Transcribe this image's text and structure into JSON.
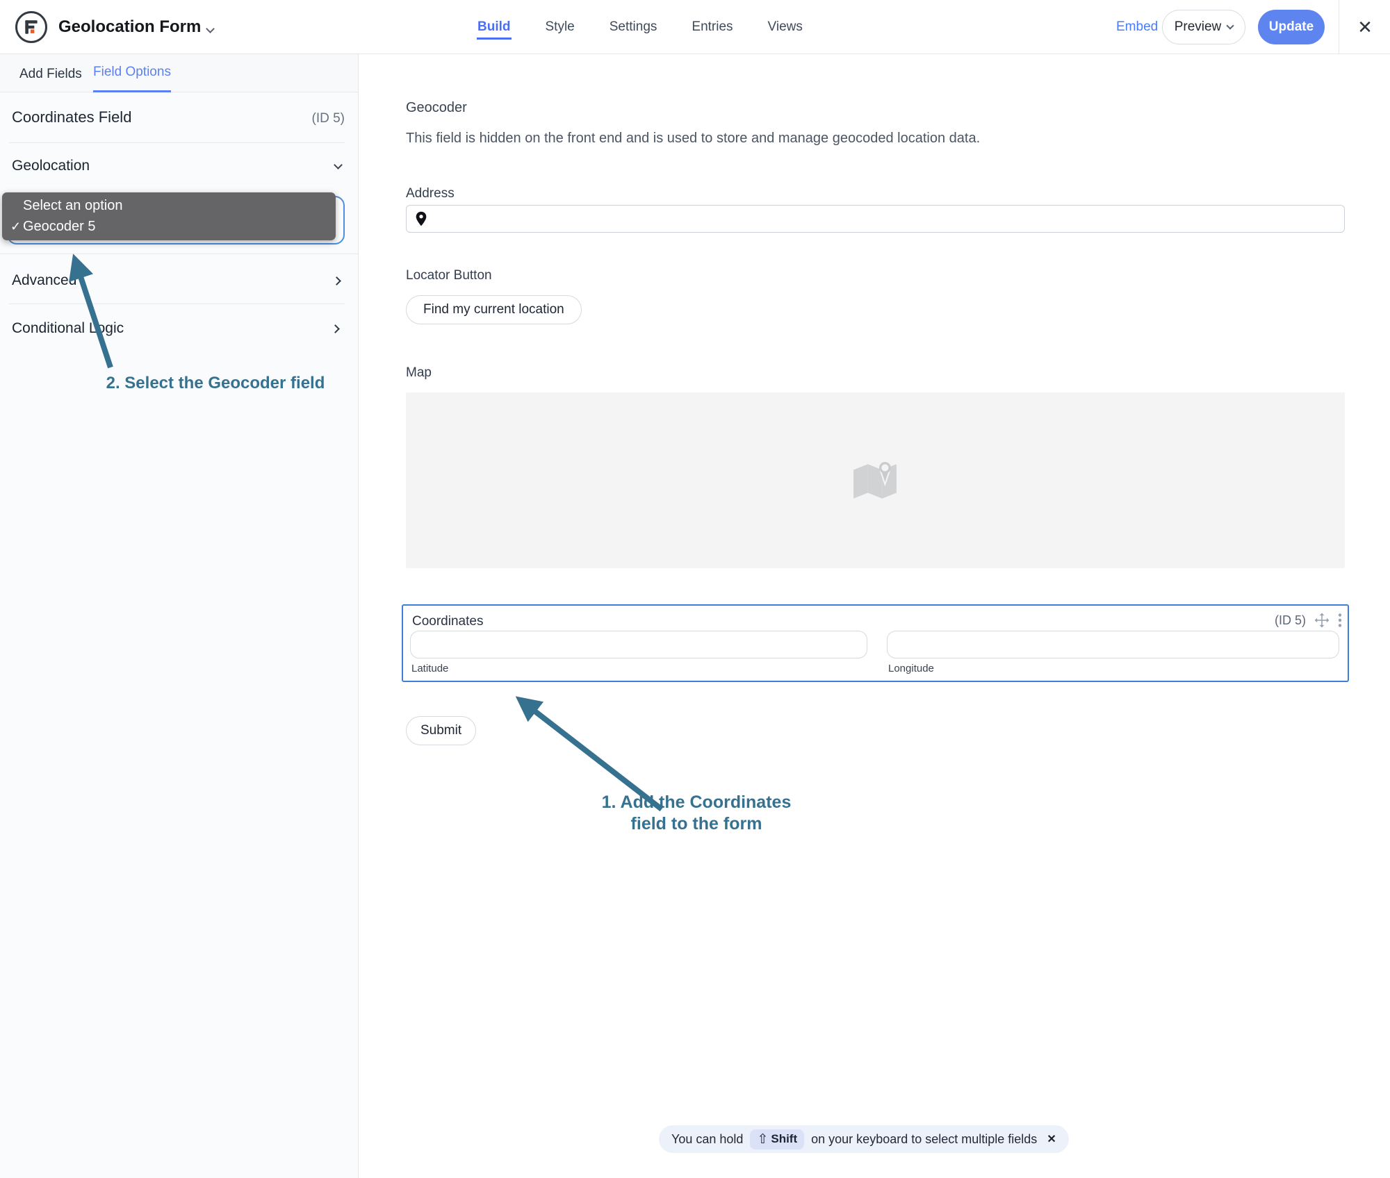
{
  "header": {
    "form_title": "Geolocation Form",
    "tabs": [
      {
        "label": "Build",
        "active": true
      },
      {
        "label": "Style",
        "active": false
      },
      {
        "label": "Settings",
        "active": false
      },
      {
        "label": "Entries",
        "active": false
      },
      {
        "label": "Views",
        "active": false
      }
    ],
    "embed_label": "Embed",
    "preview_label": "Preview",
    "update_label": "Update"
  },
  "sidebar": {
    "tabs": [
      {
        "label": "Add Fields",
        "active": false
      },
      {
        "label": "Field Options",
        "active": true
      }
    ],
    "field_title": "Coordinates Field",
    "field_id": "(ID 5)",
    "sections": [
      {
        "label": "Geolocation",
        "state": "expanded"
      },
      {
        "label": "Advanced",
        "state": "collapsed"
      },
      {
        "label": "Conditional Logic",
        "state": "collapsed"
      }
    ],
    "geocoder_dropdown": {
      "options": [
        "Select an option",
        "Geocoder 5"
      ],
      "selected": "Geocoder 5"
    }
  },
  "form": {
    "geocoder_label": "Geocoder",
    "geocoder_description": "This field is hidden on the front end and is used to store and manage geocoded location data.",
    "address_label": "Address",
    "address_value": "",
    "locator_label": "Locator Button",
    "locator_button_label": "Find my current location",
    "map_label": "Map",
    "coordinates": {
      "label": "Coordinates",
      "id_badge": "(ID 5)",
      "latitude_label": "Latitude",
      "latitude_value": "",
      "longitude_label": "Longitude",
      "longitude_value": ""
    },
    "submit_label": "Submit"
  },
  "annotations": {
    "step1_line1": "1. Add the Coordinates",
    "step1_line2": "field to the form",
    "step2": "2. Select the Geocoder field",
    "color": "#36718f"
  },
  "toast": {
    "pre": "You can hold",
    "key": "Shift",
    "post": "on your keyboard to select multiple fields"
  },
  "icons": {
    "check": "✓",
    "shift": "⇧",
    "close": "✕"
  },
  "colors": {
    "accent_blue": "#4a6ff3",
    "update_button": "#5e85ef",
    "embed_link": "#4a7cf6",
    "annotation": "#36718f",
    "dropdown_bg": "#656567",
    "selected_field_border": "#3f7ed6",
    "select_focus_border": "#4a90e2",
    "map_placeholder_bg": "#f4f4f5",
    "toast_bg": "#edf1f9",
    "key_badge_bg": "#dbe2f8",
    "logo_orange": "#ec5d2a"
  }
}
